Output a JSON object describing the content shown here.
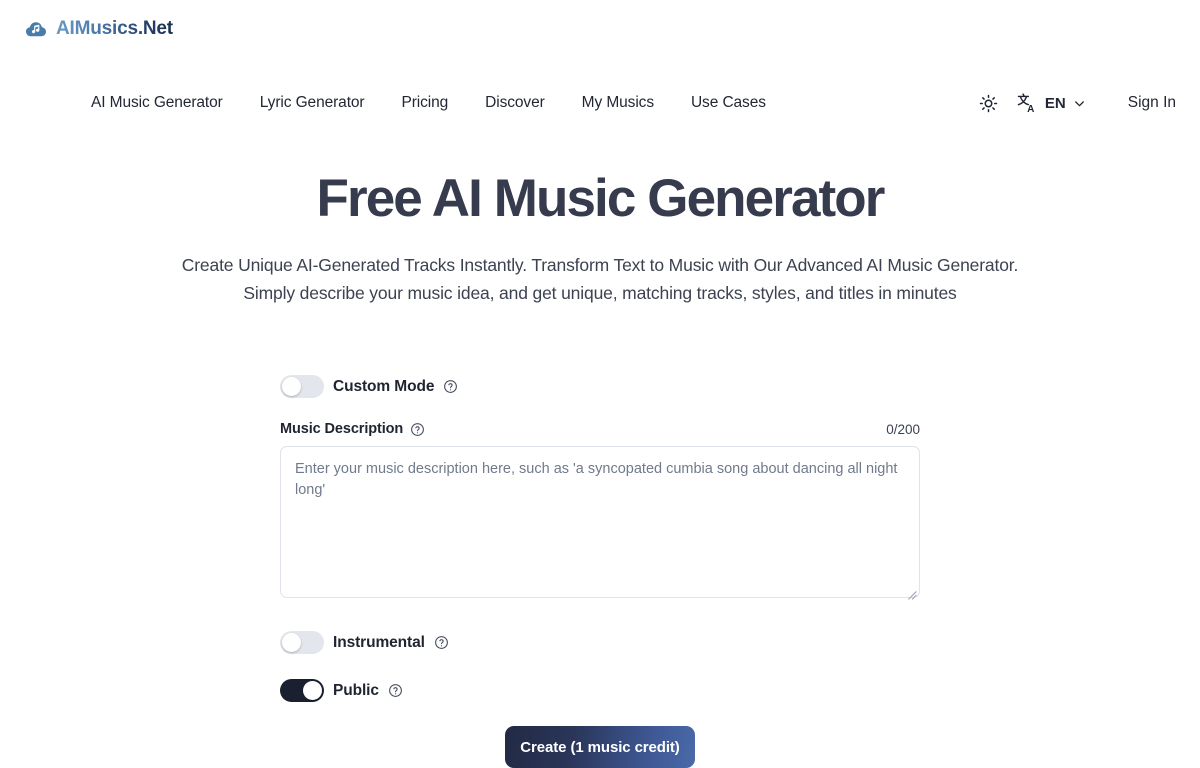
{
  "brand": {
    "name": "AIMusics.Net",
    "icon": "cloud-music-note-icon",
    "gradient_from": "#6a9bc4",
    "gradient_to": "#1d2e4f"
  },
  "nav": {
    "links": [
      {
        "label": "AI Music Generator"
      },
      {
        "label": "Lyric Generator"
      },
      {
        "label": "Pricing"
      },
      {
        "label": "Discover"
      },
      {
        "label": "My Musics"
      },
      {
        "label": "Use Cases"
      }
    ],
    "theme_toggle_icon": "sun-icon",
    "language": {
      "icon": "translate-icon",
      "value": "EN",
      "chevron": "chevron-down-icon"
    },
    "sign_in": "Sign In"
  },
  "hero": {
    "title": "Free AI Music Generator",
    "subtitle": "Create Unique AI-Generated Tracks Instantly. Transform Text to Music with Our Advanced AI Music Generator. Simply describe your music idea, and get unique, matching tracks, styles, and titles in minutes",
    "title_color": "#363b4d"
  },
  "form": {
    "custom_mode": {
      "label": "Custom Mode",
      "state": "off",
      "help_icon": "question-circle-icon"
    },
    "music_description": {
      "label": "Music Description",
      "help_icon": "question-circle-icon",
      "counter": "0/200",
      "value": "",
      "placeholder": "Enter your music description here, such as 'a syncopated cumbia song about dancing all night long'"
    },
    "instrumental": {
      "label": "Instrumental",
      "state": "off",
      "help_icon": "question-circle-icon"
    },
    "public": {
      "label": "Public",
      "state": "on",
      "help_icon": "question-circle-icon",
      "on_color": "#1b2030"
    },
    "submit": {
      "label": "Create (1 music credit)",
      "gradient_from": "#222a44",
      "gradient_to": "#4a6aa8"
    }
  }
}
